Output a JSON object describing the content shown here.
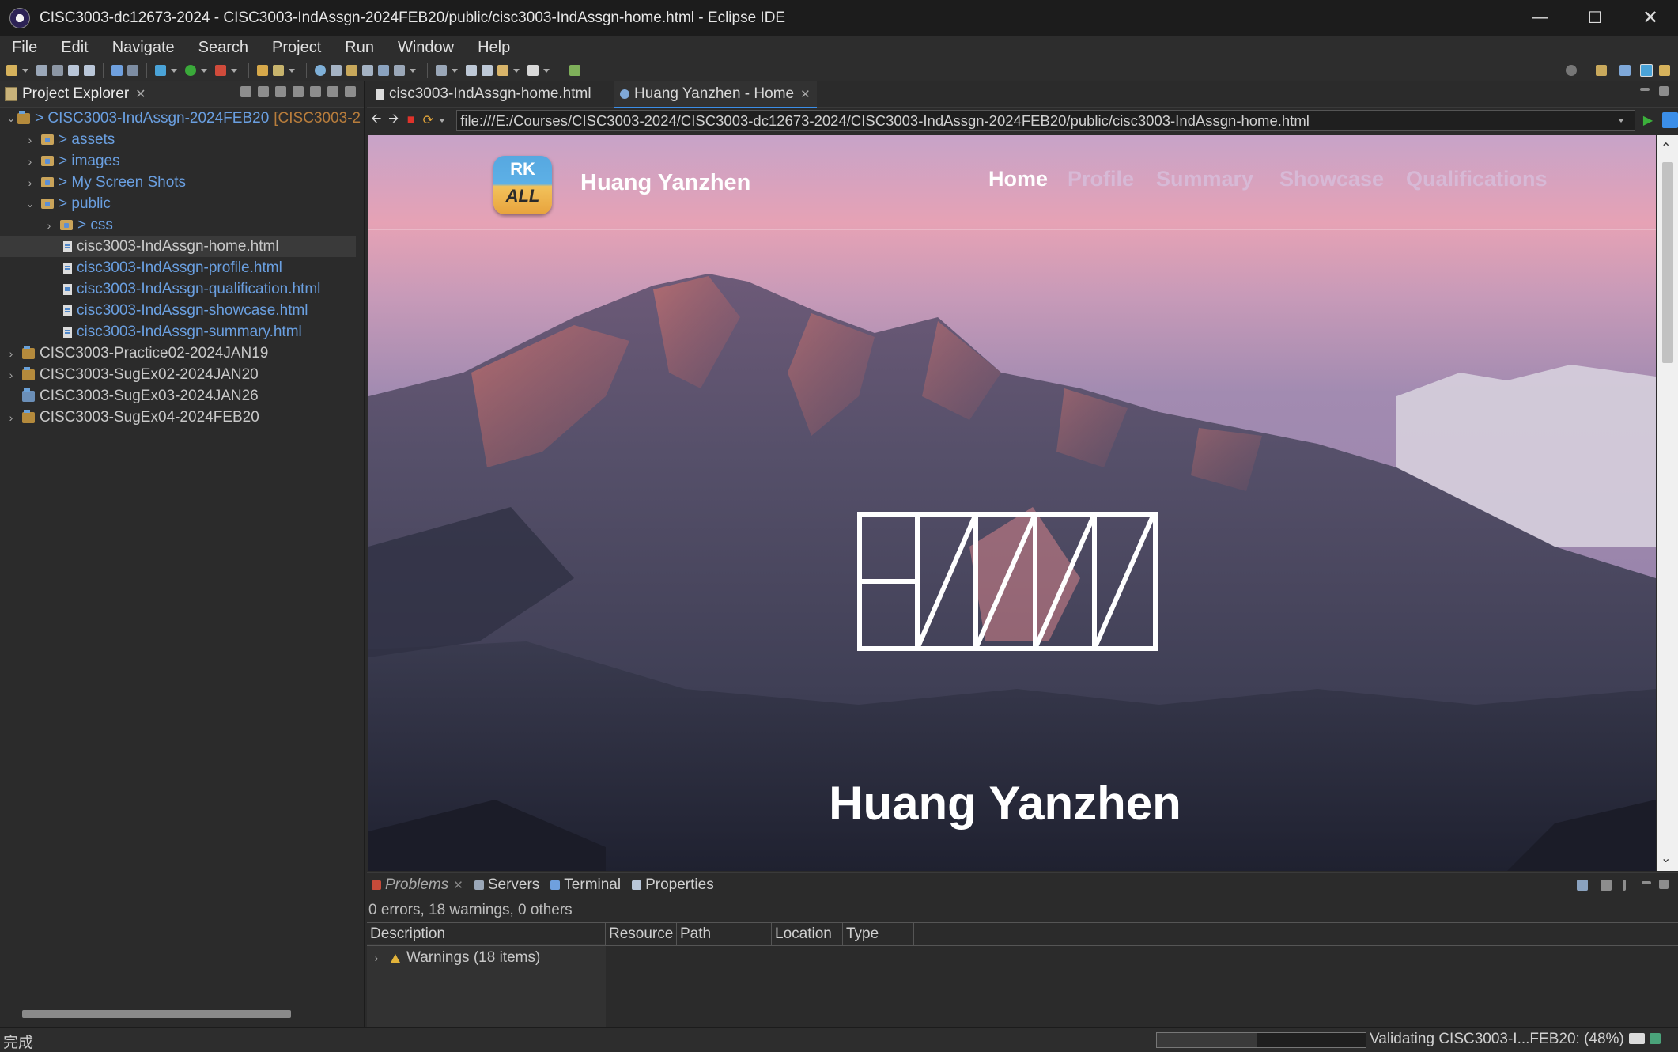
{
  "window": {
    "title": "CISC3003-dc12673-2024 - CISC3003-IndAssgn-2024FEB20/public/cisc3003-IndAssgn-home.html - Eclipse IDE"
  },
  "menu": [
    "File",
    "Edit",
    "Navigate",
    "Search",
    "Project",
    "Run",
    "Window",
    "Help"
  ],
  "explorer": {
    "title": "Project Explorer",
    "tree": {
      "root_project": "> CISC3003-IndAssgn-2024FEB20",
      "root_project_suffix": "[CISC3003-2",
      "assets": "> assets",
      "images": "> images",
      "screenshots": "> My Screen Shots",
      "public": "> public",
      "css": "> css",
      "files": [
        "cisc3003-IndAssgn-home.html",
        "cisc3003-IndAssgn-profile.html",
        "cisc3003-IndAssgn-qualification.html",
        "cisc3003-IndAssgn-showcase.html",
        "cisc3003-IndAssgn-summary.html"
      ],
      "other_projects": [
        "CISC3003-Practice02-2024JAN19",
        "CISC3003-SugEx02-2024JAN20",
        "CISC3003-SugEx03-2024JAN26",
        "CISC3003-SugEx04-2024FEB20"
      ]
    }
  },
  "editor": {
    "tabs": {
      "source": "cisc3003-IndAssgn-home.html",
      "browser": "Huang Yanzhen - Home"
    },
    "url": "file:///E:/Courses/CISC3003-2024/CISC3003-dc12673-2024/CISC3003-IndAssgn-2024FEB20/public/cisc3003-IndAssgn-home.html"
  },
  "webpage": {
    "logo_top": "RK",
    "logo_bottom": "ALL",
    "site_name": "Huang Yanzhen",
    "nav": {
      "home": "Home",
      "profile": "Profile",
      "summary": "Summary",
      "showcase": "Showcase",
      "qualifications": "Qualifications"
    },
    "hero_name": "Huang Yanzhen"
  },
  "bottom_panel": {
    "tabs": {
      "problems": "Problems",
      "servers": "Servers",
      "terminal": "Terminal",
      "properties": "Properties"
    },
    "summary": "0 errors, 18 warnings, 0 others",
    "columns": {
      "description": "Description",
      "resource": "Resource",
      "path": "Path",
      "location": "Location",
      "type": "Type"
    },
    "warnings_row": "Warnings (18 items)"
  },
  "status": {
    "left": "完成",
    "progress_text": "Validating CISC3003-I...FEB20: (48%)",
    "progress_fraction": 0.48
  },
  "colors": {
    "accent": "#3b8ee8",
    "link_blue": "#6a9fe0",
    "warning": "#e2b33a"
  }
}
